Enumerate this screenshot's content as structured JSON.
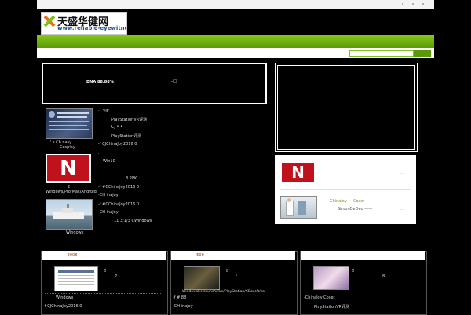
{
  "header": {
    "logo_cn": "天盛华健网",
    "logo_url": "www.reliable-eyewitness.c"
  },
  "search": {
    "placeholder": "",
    "button_label": ""
  },
  "banner": {
    "text_left": "DNA  88.88%",
    "text_right": "...□"
  },
  "news_left": {
    "item1": {
      "thumb_caption": "' s    Ch  nasy",
      "thumb_caption2": "Cosplay",
      "lines": [
        "VIP",
        "PlayStationVR评测",
        "CJ            • •",
        "PlayStation评测",
        "-f      CJChinaJoy2016        0"
      ]
    },
    "item2": {
      "thumb_letter": "N",
      "lines": [
        "Win10",
        "",
        "",
        "8                    2PK"
      ],
      "caption_a": "2",
      "caption_b": "Windows/Pro/Mac/Android",
      "lines2": [
        "-f      #CChinaJoy2016        0",
        "-CH inajoy"
      ]
    },
    "item3": {
      "thumb_caption": "Windows",
      "lines": [
        "-f      #CChinaJoy2016        0",
        "-CH inajoy",
        "11 3:1/3 CWindows"
      ]
    }
  },
  "side_panel": {
    "item1_letter": "N",
    "item1_text": "...",
    "item2_title_a": "ChinaJoy",
    "item2_title_b": "Coser",
    "item2_sub": "SimonDeDeo   ——",
    "item2_more": "..."
  },
  "bottom_cards": {
    "card1": {
      "tab": "2008",
      "lines": [
        "Windows",
        "-f      CJChinaJoy2016        0",
        "-CH inajoy"
      ],
      "side": [
        "8",
        "7"
      ]
    },
    "card2": {
      "tab": "500",
      "lines": [
        "WindowsFirelaunch/Tue/PlayStation/XBoxoft/ca",
        "-f       #          88",
        "-CH inajoy"
      ],
      "side": [
        "8",
        "f"
      ]
    },
    "card3": {
      "tab": "",
      "lines": [
        "-ChinaJoy       Coser",
        "PlayStationVR评测",
        "PlayStation评测"
      ],
      "side": [
        "8",
        "8"
      ]
    }
  }
}
